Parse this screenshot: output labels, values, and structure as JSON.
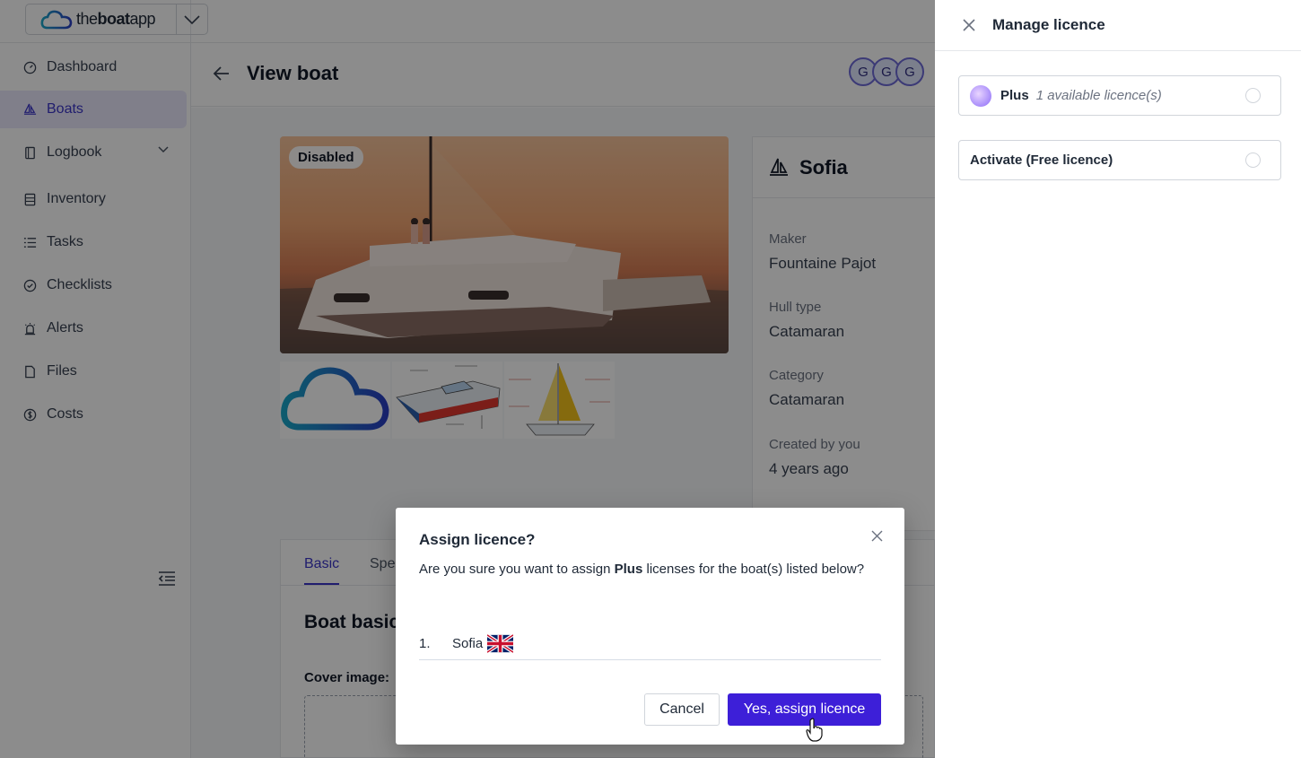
{
  "brand": {
    "name_light": "the",
    "name_bold": "boat",
    "name_suffix": "app"
  },
  "sidebar": {
    "items": [
      {
        "label": "Dashboard",
        "icon": "dashboard-icon"
      },
      {
        "label": "Boats",
        "icon": "sailboat-icon",
        "active": true
      },
      {
        "label": "Logbook",
        "icon": "book-icon",
        "expandable": true
      },
      {
        "label": "Inventory",
        "icon": "inventory-icon"
      },
      {
        "label": "Tasks",
        "icon": "list-icon"
      },
      {
        "label": "Checklists",
        "icon": "check-circle-icon"
      },
      {
        "label": "Alerts",
        "icon": "alarm-icon"
      },
      {
        "label": "Files",
        "icon": "file-icon"
      },
      {
        "label": "Costs",
        "icon": "dollar-icon"
      }
    ]
  },
  "header": {
    "title": "View boat",
    "avatars": [
      "G",
      "G",
      "G"
    ]
  },
  "boat": {
    "status_badge": "Disabled",
    "name": "Sofia",
    "fields": [
      {
        "label": "Maker",
        "value": "Fountaine Pajot"
      },
      {
        "label": "Hull type",
        "value": "Catamaran"
      },
      {
        "label": "Category",
        "value": "Catamaran"
      },
      {
        "label": "Created by you",
        "value": "4 years ago"
      }
    ]
  },
  "tabs": {
    "basic": "Basic",
    "spec": "Spec"
  },
  "section": {
    "title": "Boat basic",
    "cover_label": "Cover image:"
  },
  "drawer": {
    "title": "Manage licence",
    "options": [
      {
        "name": "Plus",
        "subtitle": "1 available licence(s)"
      },
      {
        "name": "Activate (Free licence)",
        "subtitle": ""
      }
    ]
  },
  "modal": {
    "title": "Assign licence?",
    "body_pre": "Are you sure you want to assign ",
    "body_bold": "Plus",
    "body_post": " licenses for the boat(s) listed below?",
    "list": [
      {
        "num": "1.",
        "name": "Sofia",
        "flag": "uk-flag-icon"
      }
    ],
    "cancel_label": "Cancel",
    "confirm_label": "Yes, assign licence"
  },
  "colors": {
    "primary": "#3d1fd8",
    "active_nav_bg": "#eae8fb",
    "active_nav_text": "#3b35c8"
  }
}
